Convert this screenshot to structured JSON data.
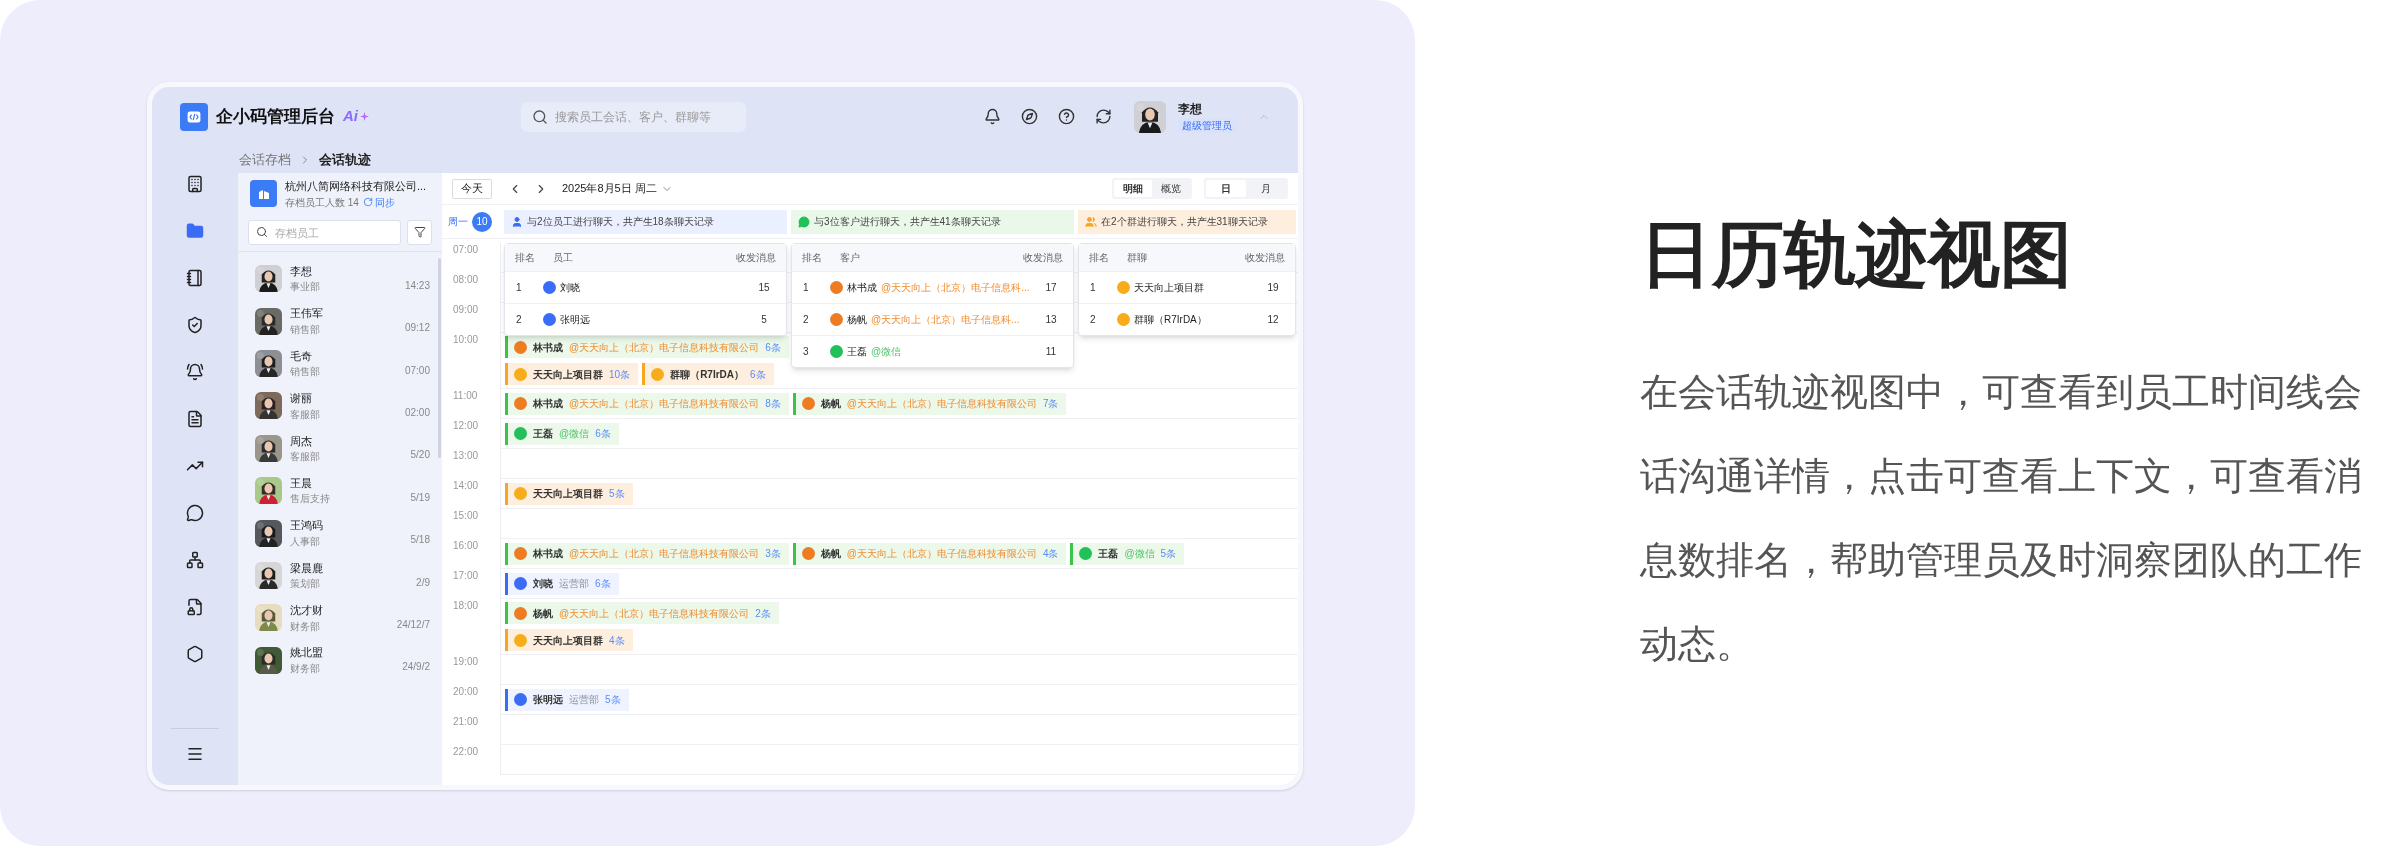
{
  "app": {
    "brand": "企小码管理后台",
    "ai": "Ai",
    "search_placeholder": "搜索员工会话、客户、群聊等",
    "user": {
      "name": "李想",
      "role": "超级管理员"
    }
  },
  "breadcrumb": [
    {
      "label": "会话存档",
      "current": false
    },
    {
      "label": "会话轨迹",
      "current": true
    }
  ],
  "nav": [
    {
      "selected": false
    },
    {
      "selected": true
    },
    {
      "selected": false
    },
    {
      "selected": false
    },
    {
      "selected": false
    },
    {
      "selected": false
    },
    {
      "selected": false
    },
    {
      "selected": false
    },
    {
      "selected": false
    },
    {
      "selected": false
    },
    {
      "selected": false
    }
  ],
  "company": {
    "name": "杭州八简网络科技有限公司...",
    "count": "存档员工人数 14",
    "sync": "同步"
  },
  "contact_search": {
    "placeholder": "存档员工"
  },
  "contacts": [
    {
      "name": "李想",
      "dept": "事业部",
      "time": "14:23"
    },
    {
      "name": "王伟军",
      "dept": "销售部",
      "time": "09:12"
    },
    {
      "name": "毛奇",
      "dept": "销售部",
      "time": "07:00"
    },
    {
      "name": "谢丽",
      "dept": "客服部",
      "time": "02:00"
    },
    {
      "name": "周杰",
      "dept": "客服部",
      "time": "5/20"
    },
    {
      "name": "王晨",
      "dept": "售后支持",
      "time": "5/19"
    },
    {
      "name": "王鸿码",
      "dept": "人事部",
      "time": "5/18"
    },
    {
      "name": "梁晨鹿",
      "dept": "策划部",
      "time": "2/9"
    },
    {
      "name": "沈才财",
      "dept": "财务部",
      "time": "24/12/7"
    },
    {
      "name": "姚北盟",
      "dept": "财务部",
      "time": "24/9/2"
    }
  ],
  "calendar": {
    "today": "今天",
    "date": "2025年8月5日 周二",
    "view_modes": [
      {
        "label": "明细",
        "selected": true
      },
      {
        "label": "概览",
        "selected": false
      }
    ],
    "ranges": [
      {
        "label": "日",
        "selected": true
      },
      {
        "label": "月",
        "selected": false
      }
    ],
    "weekday": "周一",
    "day": "10",
    "summaries": [
      {
        "kind": "employee",
        "text": "与2位员工进行聊天，共产生18条聊天记录",
        "columns": [
          "排名",
          "员工",
          "收发消息"
        ],
        "rows": [
          {
            "rank": "1",
            "kind": "employee",
            "name": "刘晓",
            "count": "15"
          },
          {
            "rank": "2",
            "kind": "employee",
            "name": "张明远",
            "count": "5"
          }
        ]
      },
      {
        "kind": "customer",
        "text": "与3位客户进行聊天，共产生41条聊天记录",
        "columns": [
          "排名",
          "客户",
          "收发消息"
        ],
        "rows": [
          {
            "rank": "1",
            "kind": "customer",
            "name": "林书成",
            "note": "@天天向上（北京）电子信息科...",
            "count": "17"
          },
          {
            "rank": "2",
            "kind": "customer",
            "name": "杨帆",
            "note": "@天天向上（北京）电子信息科...",
            "count": "13"
          },
          {
            "rank": "3",
            "kind": "wechat_customer",
            "name": "王磊",
            "note": "@微信",
            "count": "11"
          }
        ]
      },
      {
        "kind": "group",
        "text": "在2个群进行聊天，共产生31聊天记录",
        "columns": [
          "排名",
          "群聊",
          "收发消息"
        ],
        "rows": [
          {
            "rank": "1",
            "kind": "group",
            "name": "天天向上项目群",
            "count": "19"
          },
          {
            "rank": "2",
            "kind": "group",
            "name": "群聊（R7IrDA）",
            "count": "12"
          }
        ]
      }
    ],
    "hours": [
      {
        "time": "07:00"
      },
      {
        "time": "08:00"
      },
      {
        "time": "09:00"
      },
      {
        "time": "10:00",
        "lanes": [
          [
            {
              "kind": "customer",
              "name": "林书成",
              "note": "@天天向上（北京）电子信息科技有限公司",
              "count": "6条"
            }
          ],
          [
            {
              "kind": "group",
              "name": "天天向上项目群",
              "count": "10条"
            },
            {
              "kind": "group",
              "name": "群聊（R7IrDA）",
              "count": "6条"
            }
          ]
        ]
      },
      {
        "time": "11:00",
        "lanes": [
          [
            {
              "kind": "customer",
              "name": "林书成",
              "note": "@天天向上（北京）电子信息科技有限公司",
              "count": "8条"
            },
            {
              "kind": "customer",
              "name": "杨帆",
              "note": "@天天向上（北京）电子信息科技有限公司",
              "count": "7条"
            }
          ]
        ]
      },
      {
        "time": "12:00",
        "lanes": [
          [
            {
              "kind": "wechat_customer",
              "name": "王磊",
              "note": "@微信",
              "count": "6条"
            }
          ]
        ]
      },
      {
        "time": "13:00"
      },
      {
        "time": "14:00",
        "lanes": [
          [
            {
              "kind": "group",
              "name": "天天向上项目群",
              "count": "5条"
            }
          ]
        ]
      },
      {
        "time": "15:00"
      },
      {
        "time": "16:00",
        "lanes": [
          [
            {
              "kind": "customer",
              "name": "林书成",
              "note": "@天天向上（北京）电子信息科技有限公司",
              "count": "3条"
            },
            {
              "kind": "customer",
              "name": "杨帆",
              "note": "@天天向上（北京）电子信息科技有限公司",
              "count": "4条"
            },
            {
              "kind": "wechat_customer",
              "name": "王磊",
              "note": "@微信",
              "count": "5条"
            }
          ]
        ]
      },
      {
        "time": "17:00",
        "lanes": [
          [
            {
              "kind": "employee",
              "name": "刘晓",
              "note": "运营部",
              "count": "6条"
            }
          ]
        ]
      },
      {
        "time": "18:00",
        "lanes": [
          [
            {
              "kind": "customer",
              "name": "杨帆",
              "note": "@天天向上（北京）电子信息科技有限公司",
              "count": "2条"
            }
          ],
          [
            {
              "kind": "group",
              "name": "天天向上项目群",
              "count": "4条"
            }
          ]
        ]
      },
      {
        "time": "19:00"
      },
      {
        "time": "20:00",
        "lanes": [
          [
            {
              "kind": "employee",
              "name": "张明远",
              "note": "运营部",
              "count": "5条"
            }
          ]
        ]
      },
      {
        "time": "21:00"
      },
      {
        "time": "22:00"
      }
    ]
  },
  "feature": {
    "title": "日历轨迹视图",
    "description": "在会话轨迹视图中，可查看到员工时间线会话沟通详情，点击可查看上下文，可查看消息数排名，帮助管理员及时洞察团队的工作动态。"
  }
}
